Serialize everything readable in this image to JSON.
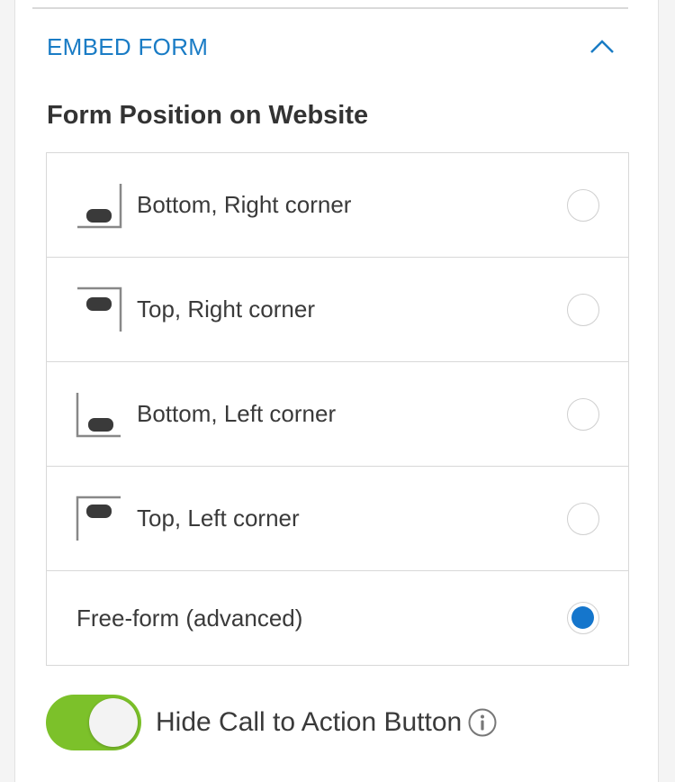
{
  "section": {
    "title": "EMBED FORM",
    "collapse_icon": "chevron-up-icon"
  },
  "form_position": {
    "heading": "Form Position on Website",
    "options": [
      {
        "label": "Bottom, Right corner",
        "icon": "bottom-right-position-icon",
        "selected": false
      },
      {
        "label": "Top, Right corner",
        "icon": "top-right-position-icon",
        "selected": false
      },
      {
        "label": "Bottom, Left corner",
        "icon": "bottom-left-position-icon",
        "selected": false
      },
      {
        "label": "Top, Left corner",
        "icon": "top-left-position-icon",
        "selected": false
      },
      {
        "label": "Free-form (advanced)",
        "icon": "",
        "selected": true
      }
    ]
  },
  "hide_cta": {
    "label": "Hide Call to Action Button",
    "enabled": true,
    "info_icon": "info-icon"
  },
  "colors": {
    "accent": "#1a7cc5",
    "radio_selected": "#1576cc",
    "toggle_on": "#7cc12a"
  }
}
